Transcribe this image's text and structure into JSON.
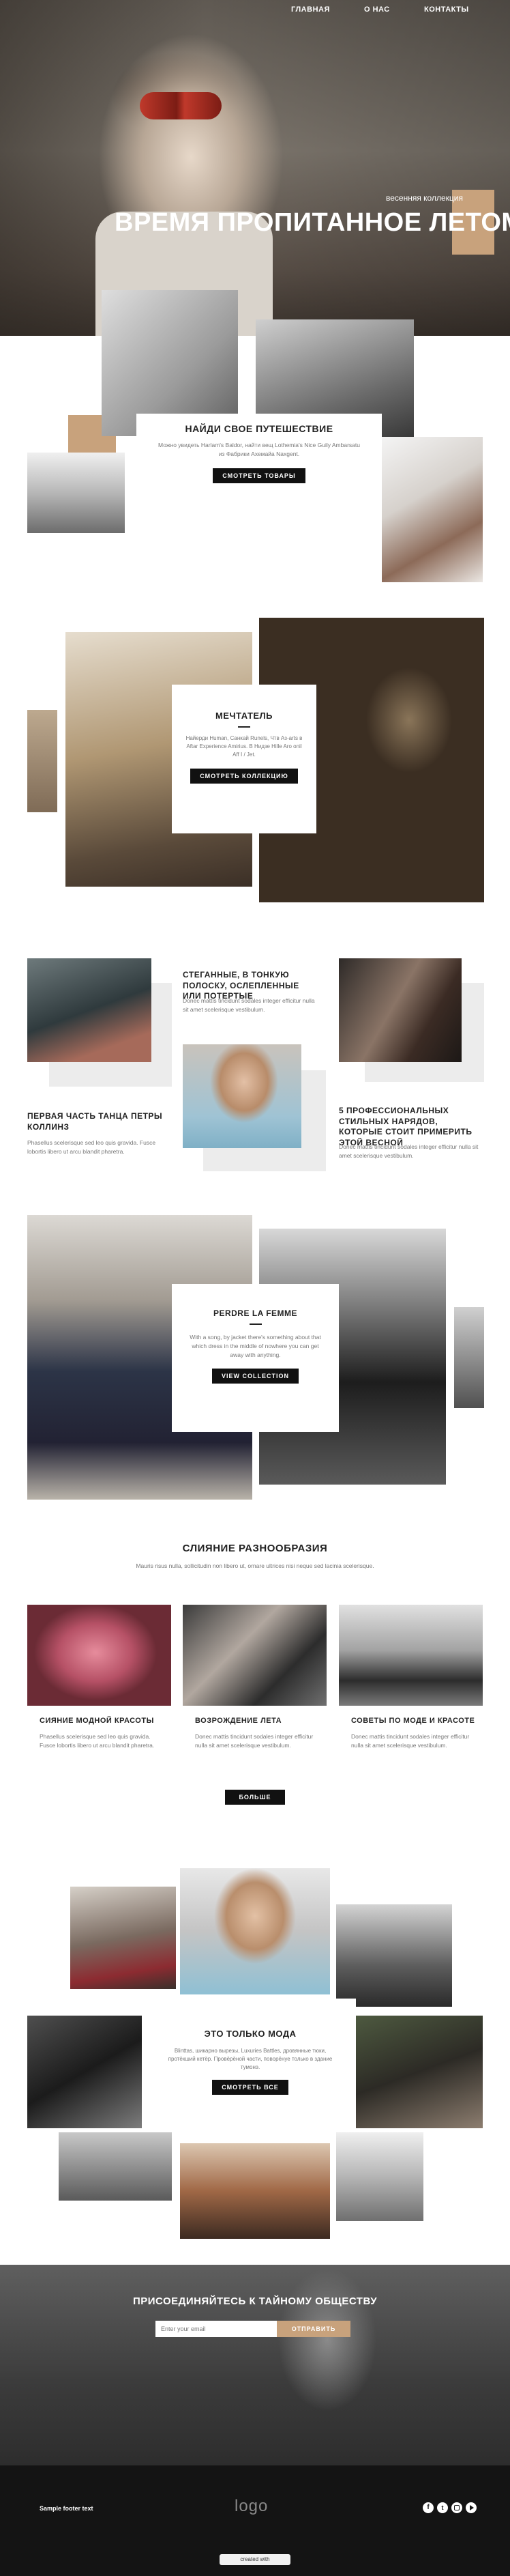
{
  "nav": {
    "home": "ГЛАВНАЯ",
    "about": "О НАС",
    "contacts": "КОНТАКТЫ"
  },
  "hero": {
    "kicker": "весенняя коллекция",
    "title": "ВРЕМЯ ПРОПИТАННОЕ ЛЕТОМ"
  },
  "s1": {
    "title": "НАЙДИ СВОЕ ПУТЕШЕСТВИЕ",
    "text": "Можно увидеть Harlam's Baldor, найти вещ Lothemia's Nice Guily Ambarsatu из Фабрики Ахемайа Naxgent.",
    "button": "СМОТРЕТЬ ТОВАРЫ"
  },
  "s2": {
    "title": "МЕЧТАТЕЛЬ",
    "text": "Найерди Human, Санкай Runels, Чтв Аз-arts в Aftar Experience Amirius. В Нидзе Hille Aro onil Aff I / Jet.",
    "button": "СМОТРЕТЬ КОЛЛЕКЦИЮ"
  },
  "s3": {
    "c1": {
      "title": "ПЕРВАЯ ЧАСТЬ ТАНЦА ПЕТРЫ КОЛЛИНЗ",
      "text": "Phasellus scelerisque sed leo quis gravida. Fusce lobortis libero ut arcu blandit pharetra."
    },
    "c2": {
      "title": "СТЕГАННЫЕ, В ТОНКУЮ ПОЛОСКУ, ОСЛЕПЛЕННЫЕ ИЛИ ПОТЕРТЫЕ",
      "text": "Donec mattis tincidunt sodales integer efficitur nulla sit amet scelerisque vestibulum."
    },
    "c3": {
      "title": "5 ПРОФЕССИОНАЛЬНЫХ СТИЛЬНЫХ НАРЯДОВ, КОТОРЫЕ СТОИТ ПРИМЕРИТЬ ЭТОЙ ВЕСНОЙ",
      "text": "Donec mattis tincidunt sodales integer efficitur nulla sit amet scelerisque vestibulum."
    }
  },
  "s4": {
    "title": "PERDRE LA FEMME",
    "text": "With a song, by jacket there's something about that which dress in the middle of nowhere you can get away with anything.",
    "button": "VIEW COLLECTION"
  },
  "s5": {
    "title": "СЛИЯНИЕ РАЗНООБРАЗИЯ",
    "text": "Mauris risus nulla, sollicitudin non libero ut, ornare ultrices nisi neque sed lacinia scelerisque.",
    "cards": [
      {
        "title": "СИЯНИЕ МОДНОЙ КРАСОТЫ",
        "text": "Phasellus scelerisque sed leo quis gravida. Fusce lobortis libero ut arcu blandit pharetra."
      },
      {
        "title": "ВОЗРОЖДЕНИЕ ЛЕТА",
        "text": "Donec mattis tincidunt sodales integer efficitur nulla sit amet scelerisque vestibulum."
      },
      {
        "title": "СОВЕТЫ ПО МОДЕ И КРАСОТЕ",
        "text": "Donec mattis tincidunt sodales integer efficitur nulla sit amet scelerisque vestibulum."
      }
    ],
    "button": "БОЛЬШЕ"
  },
  "s6": {
    "title": "ЭТО ТОЛЬКО МОДА",
    "text": "Blinttas, шикарно вырезы, Luxuries Battles, дровянные тюки, протёкший кетёр. Провёрёной части, поворёнуе только в здание тумонэ.",
    "button": "СМОТРЕТЬ ВСЕ"
  },
  "newsletter": {
    "title": "ПРИСОЕДИНЯЙТЕСЬ К ТАЙНОМУ ОБЩЕСТВУ",
    "placeholder": "Enter your email",
    "button": "ОТПРАВИТЬ"
  },
  "footer": {
    "left": "Sample footer text",
    "logo": "logo",
    "badge": "created with"
  },
  "colors": {
    "accent": "#c8a27c",
    "dark": "#141414"
  },
  "icons": [
    "facebook-icon",
    "twitter-icon",
    "instagram-icon",
    "youtube-icon"
  ]
}
